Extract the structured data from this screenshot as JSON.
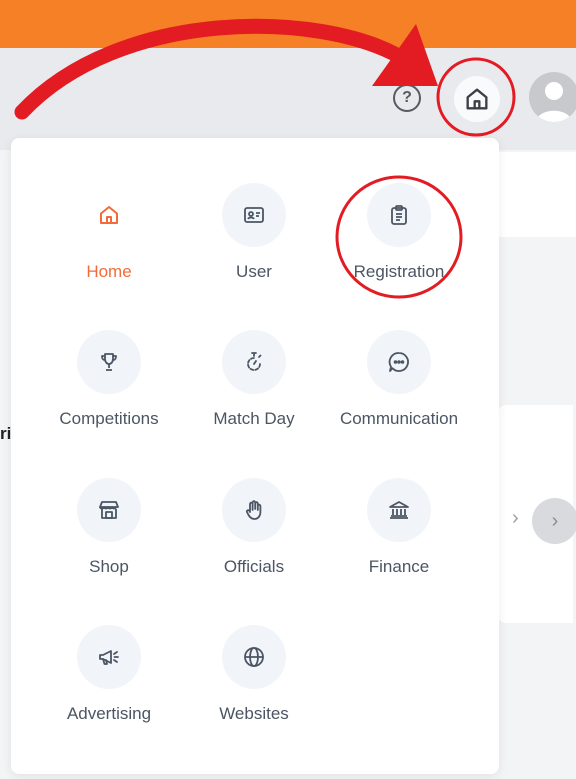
{
  "header": {
    "help_icon": "help-circle-icon",
    "help_glyph": "?",
    "home_icon": "home-icon",
    "avatar_icon": "user-avatar-icon"
  },
  "background": {
    "partial_text": "ri",
    "chevron": "›",
    "circle_chevron": "›"
  },
  "menu": {
    "items": [
      {
        "label": "Home",
        "icon": "home-icon",
        "active": true
      },
      {
        "label": "User",
        "icon": "id-card-icon"
      },
      {
        "label": "Registration",
        "icon": "clipboard-icon"
      },
      {
        "label": "Competitions",
        "icon": "trophy-icon"
      },
      {
        "label": "Match Day",
        "icon": "stopwatch-icon"
      },
      {
        "label": "Communication",
        "icon": "chat-bubble-icon"
      },
      {
        "label": "Shop",
        "icon": "storefront-icon"
      },
      {
        "label": "Officials",
        "icon": "hand-icon"
      },
      {
        "label": "Finance",
        "icon": "bank-icon"
      },
      {
        "label": "Advertising",
        "icon": "megaphone-icon"
      },
      {
        "label": "Websites",
        "icon": "globe-icon"
      }
    ]
  },
  "colors": {
    "brand_orange": "#f58025",
    "active_orange": "#f26b3a",
    "annotation_red": "#e31b23",
    "icon_gray": "#4b5563"
  }
}
